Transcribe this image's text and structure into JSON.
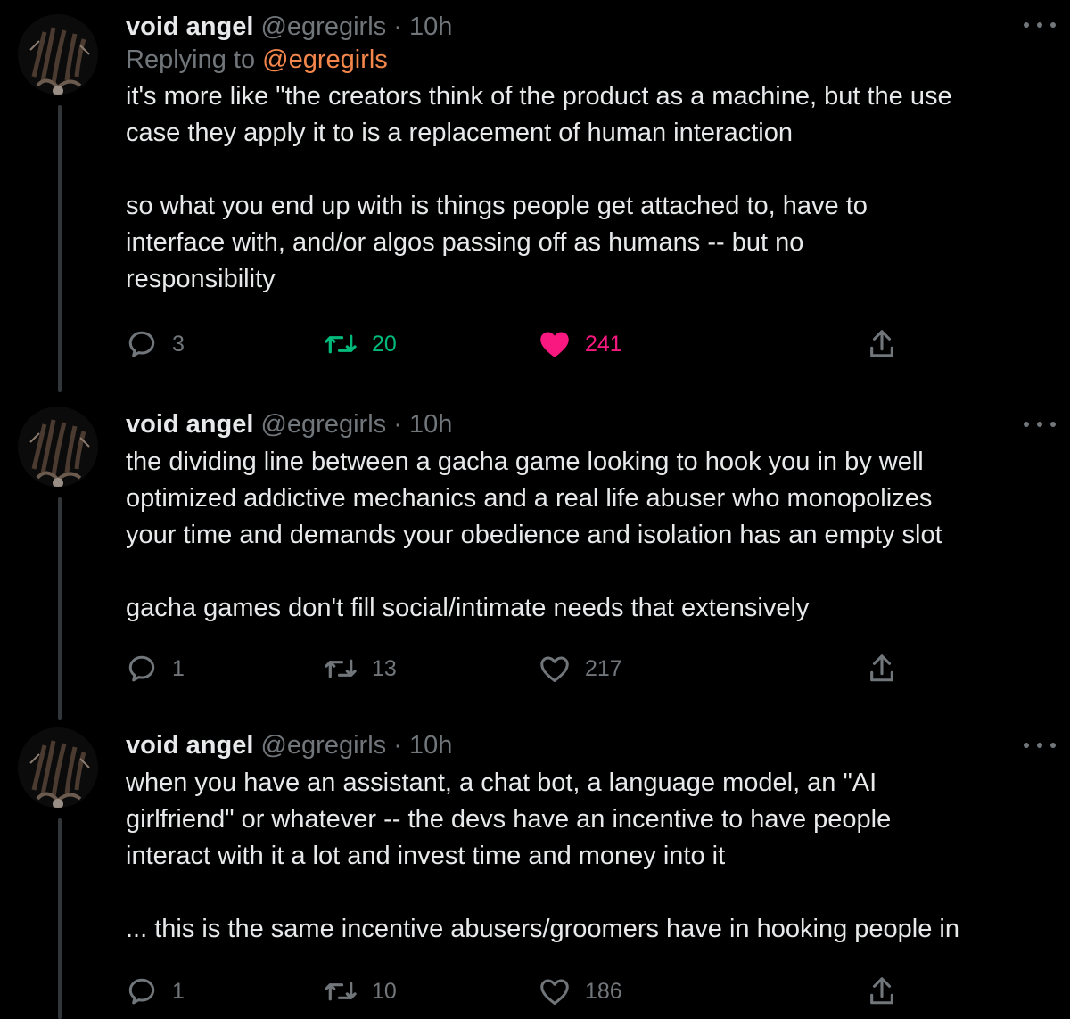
{
  "tweets": [
    {
      "display_name": "void angel",
      "handle": "@egregirls",
      "separator": "·",
      "time": "10h",
      "replying_prefix": "Replying to ",
      "replying_to": "@egregirls",
      "paragraphs": [
        "it's more like \"the creators think of the product as a machine, but the use\ncase they apply it to is a replacement of human interaction",
        "so what you end up with is things people get attached to, have to\ninterface with, and/or algos passing off as humans -- but no\nresponsibility"
      ],
      "replies": "3",
      "retweets": "20",
      "likes": "241",
      "retweeted": true,
      "liked": true
    },
    {
      "display_name": "void angel",
      "handle": "@egregirls",
      "separator": "·",
      "time": "10h",
      "paragraphs": [
        "the dividing line between a gacha game looking to hook you in by well\noptimized addictive mechanics and a real life abuser who monopolizes\nyour time and demands your obedience and isolation has an empty slot",
        "gacha games don't fill social/intimate needs that extensively"
      ],
      "replies": "1",
      "retweets": "13",
      "likes": "217",
      "retweeted": false,
      "liked": false
    },
    {
      "display_name": "void angel",
      "handle": "@egregirls",
      "separator": "·",
      "time": "10h",
      "paragraphs": [
        "when you have an assistant, a chat bot, a language model, an \"AI\ngirlfriend\" or whatever -- the devs have an incentive to have people\ninteract with it a lot and invest time and money into it",
        "... this is the same incentive abusers/groomers have in hooking people in"
      ],
      "replies": "1",
      "retweets": "10",
      "likes": "186",
      "retweeted": false,
      "liked": false
    }
  ],
  "icons": {
    "reply": "reply-icon",
    "retweet": "retweet-icon",
    "like": "heart-icon",
    "share": "share-icon",
    "more": "more-icon"
  },
  "colors": {
    "background": "#000000",
    "text": "#e7e9ea",
    "secondary": "#71767b",
    "mention": "#f4874b",
    "retweet_active": "#00ba7c",
    "like_active": "#f91880",
    "thread_line": "#333639"
  }
}
